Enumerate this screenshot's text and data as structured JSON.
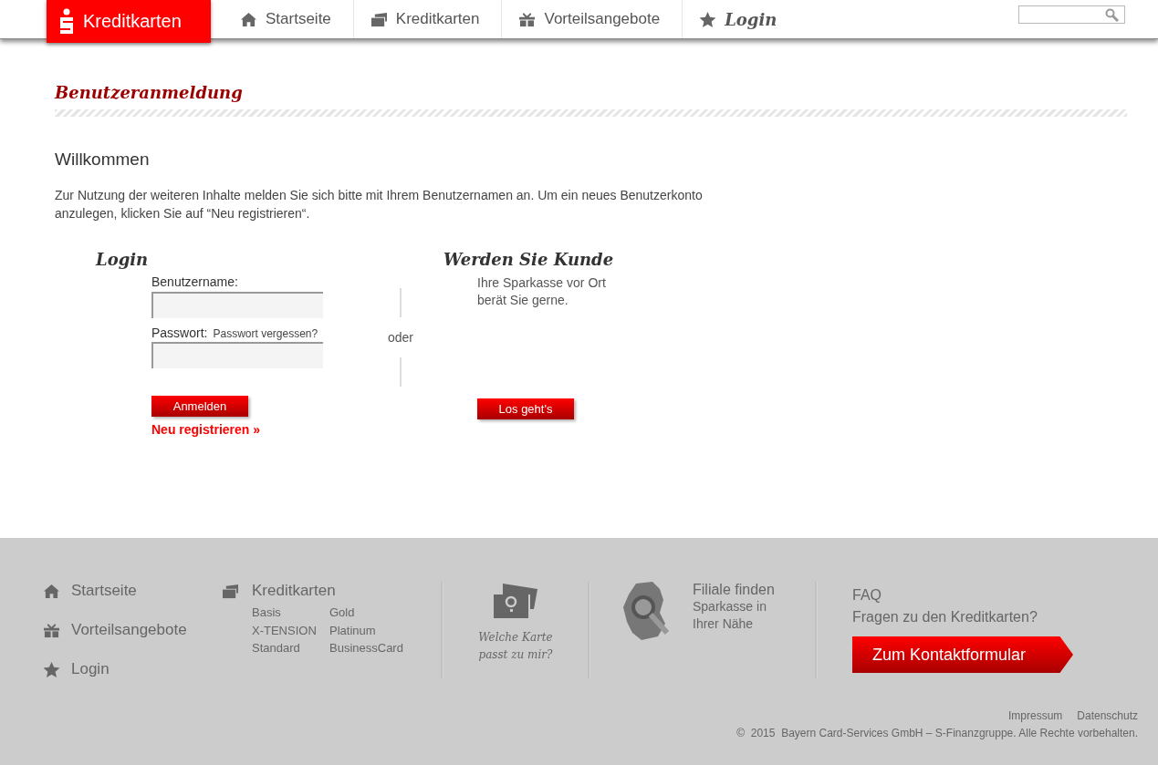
{
  "header": {
    "logo": "Kreditkarten",
    "nav": [
      {
        "label": "Startseite",
        "selected": false
      },
      {
        "label": "Kreditkarten",
        "selected": false
      },
      {
        "label": "Vorteilsangebote",
        "selected": false
      },
      {
        "label": "Login",
        "selected": true
      }
    ]
  },
  "page_title": "Benutzeranmeldung",
  "welcome": {
    "heading": "Willkommen",
    "text": "Zur Nutzung der weiteren Inhalte melden Sie sich bitte mit Ihrem Benutzernamen an. Um ein neues Benutzerkonto anzulegen, klicken Sie auf “Neu registrieren“."
  },
  "login": {
    "heading": "Login",
    "username_label": "Benutzername:",
    "password_label": "Passwort:",
    "forgot_link": "Passwort vergessen?",
    "submit": "Anmelden",
    "register_link": "Neu registrieren",
    "register_arrow": "»"
  },
  "separator": "oder",
  "customer": {
    "heading": "Werden Sie Kunde",
    "text": "Ihre Sparkasse vor Ort berät Sie gerne.",
    "button": "Los geht's"
  },
  "footer": {
    "nav": [
      "Startseite",
      "Vorteilsangebote",
      "Login"
    ],
    "cards": {
      "heading": "Kreditkarten",
      "links": [
        "Basis",
        "Gold",
        "X-TENSION",
        "Platinum",
        "Standard",
        "BusinessCard"
      ]
    },
    "card_finder": "Welche Karte passt zu mir?",
    "branch": {
      "heading": "Filiale finden",
      "text": "Sparkasse in Ihrer Nähe"
    },
    "faq": {
      "heading": "FAQ",
      "question": "Fragen zu den Kreditkarten?",
      "button": "Zum Kontaktformular"
    },
    "legal_links": [
      "Impressum",
      "Datenschutz"
    ],
    "copyright": "©  2015  Bayern Card-Services GmbH – S-Finanzgruppe. Alle Rechte vorbehalten."
  }
}
